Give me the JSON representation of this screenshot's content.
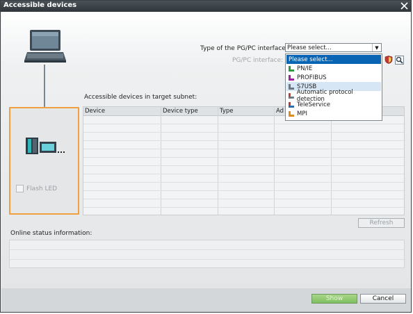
{
  "window": {
    "title": "Accessible devices"
  },
  "pgpc": {
    "type_label": "Type of the PG/PC interface:",
    "interface_label": "PG/PC interface:",
    "selected": "Please select...",
    "options": [
      {
        "label": "Please select...",
        "icon": "none",
        "state": "selected"
      },
      {
        "label": "PN/IE",
        "icon": "pnie-icon",
        "state": "normal"
      },
      {
        "label": "PROFIBUS",
        "icon": "profibus-icon",
        "state": "normal"
      },
      {
        "label": "S7USB",
        "icon": "s7usb-icon",
        "state": "hover"
      },
      {
        "label": "Automatic protocol detection",
        "icon": "auto-detect-icon",
        "state": "normal"
      },
      {
        "label": "TeleService",
        "icon": "teleservice-icon",
        "state": "normal"
      },
      {
        "label": "MPI",
        "icon": "mpi-icon",
        "state": "normal"
      }
    ]
  },
  "device_panel": {
    "flash_led_label": "Flash LED"
  },
  "subnet": {
    "label": "Accessible devices in target subnet:",
    "columns": [
      "Device",
      "Device type",
      "Type",
      "Ad"
    ],
    "rows": []
  },
  "refresh_label": "Refresh",
  "online_status": {
    "label": "Online status information:"
  },
  "buttons": {
    "show": "Show",
    "cancel": "Cancel"
  },
  "colors": {
    "accent_orange": "#f0a040",
    "selected_blue": "#0a64b4",
    "titlebar": "#2f363b",
    "show_green": "#7fbf5f"
  }
}
